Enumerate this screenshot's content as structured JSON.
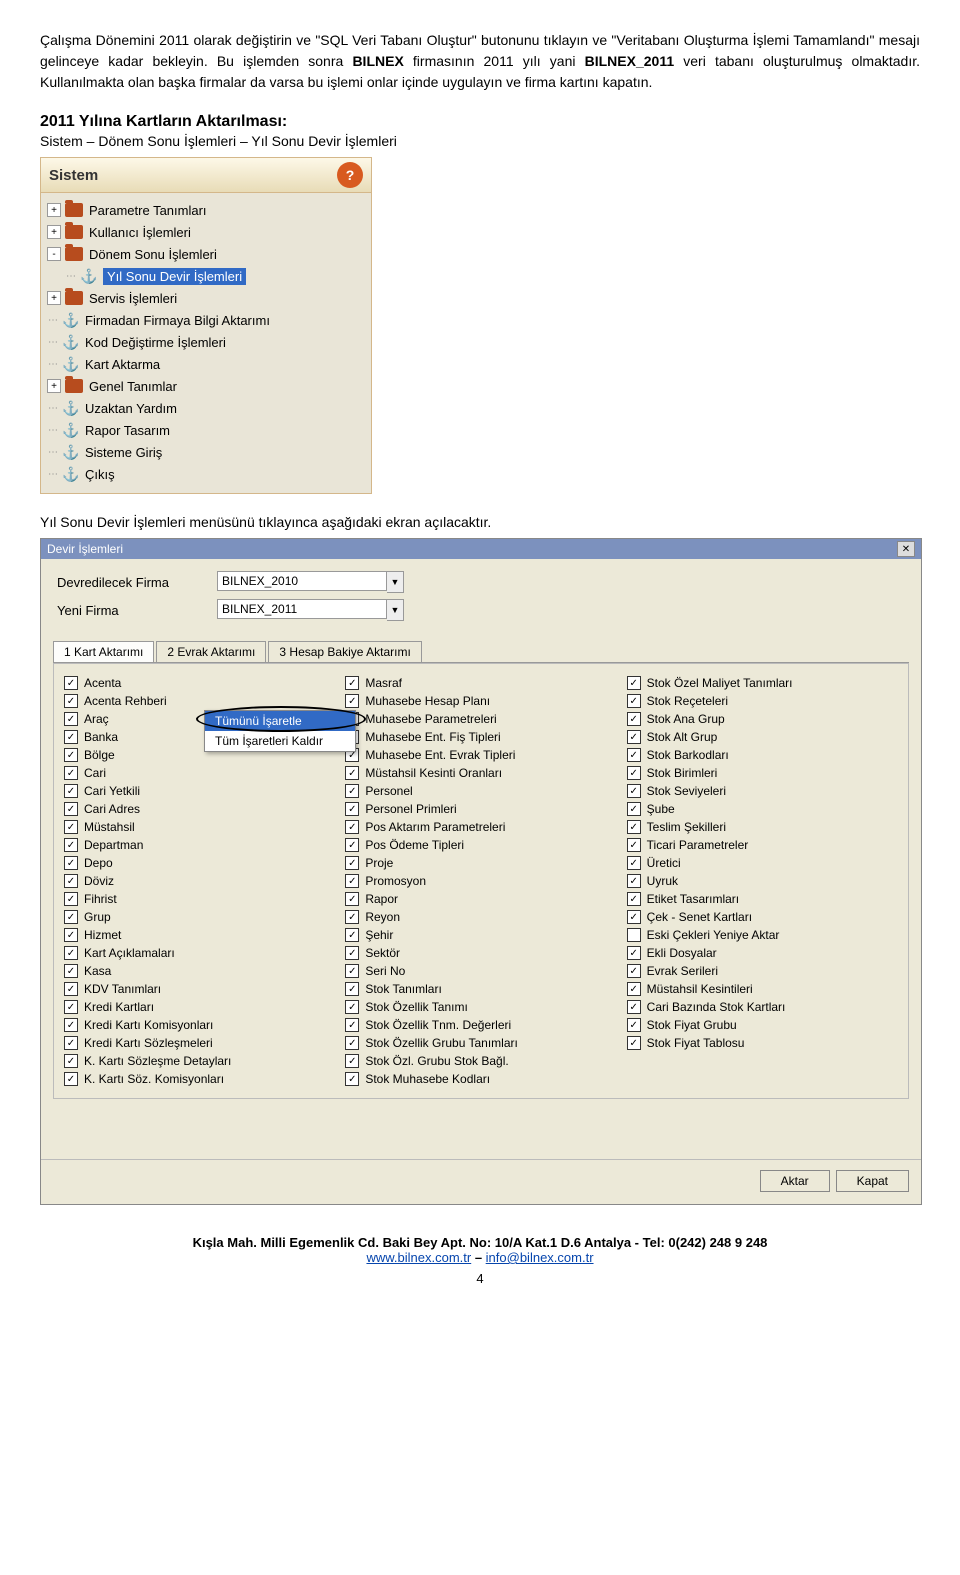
{
  "paragraph1_parts": {
    "p1": "Çalışma Dönemini 2011 olarak değiştirin ve \"SQL Veri Tabanı Oluştur\" butonunu tıklayın ve \"Veritabanı Oluşturma İşlemi Tamamlandı\" mesajı gelinceye kadar bekleyin. Bu işlemden sonra ",
    "p1b": "BILNEX",
    "p1c": " firmasının 2011 yılı yani ",
    "p1d": "BILNEX_2011",
    "p1e": " veri tabanı oluşturulmuş olmaktadır. Kullanılmakta olan başka firmalar da varsa bu işlemi onlar içinde uygulayın ve firma kartını kapatın."
  },
  "heading": "2011 Yılına Kartların Aktarılması:",
  "subline": "Sistem – Dönem Sonu İşlemleri – Yıl Sonu Devir İşlemleri",
  "sistem": {
    "title": "Sistem",
    "items": [
      {
        "exp": "+",
        "icon": "folder",
        "label": "Parametre Tanımları",
        "lvl": 1
      },
      {
        "exp": "+",
        "icon": "folder",
        "label": "Kullanıcı İşlemleri",
        "lvl": 1
      },
      {
        "exp": "-",
        "icon": "folder",
        "label": "Dönem Sonu İşlemleri",
        "lvl": 1
      },
      {
        "exp": "",
        "icon": "anchor",
        "label": "Yıl Sonu Devir İşlemleri",
        "lvl": 2,
        "hl": true
      },
      {
        "exp": "+",
        "icon": "folder",
        "label": "Servis İşlemleri",
        "lvl": 1
      },
      {
        "exp": "",
        "icon": "anchor",
        "label": "Firmadan Firmaya Bilgi Aktarımı",
        "lvl": 1
      },
      {
        "exp": "",
        "icon": "anchor",
        "label": "Kod Değiştirme İşlemleri",
        "lvl": 1
      },
      {
        "exp": "",
        "icon": "anchor",
        "label": "Kart Aktarma",
        "lvl": 1
      },
      {
        "exp": "+",
        "icon": "folder",
        "label": "Genel Tanımlar",
        "lvl": 1
      },
      {
        "exp": "",
        "icon": "anchor",
        "label": "Uzaktan Yardım",
        "lvl": 1
      },
      {
        "exp": "",
        "icon": "anchor",
        "label": "Rapor Tasarım",
        "lvl": 1
      },
      {
        "exp": "",
        "icon": "anchor",
        "label": "Sisteme Giriş",
        "lvl": 1
      },
      {
        "exp": "",
        "icon": "anchor",
        "label": "Çıkış",
        "lvl": 1
      }
    ]
  },
  "afterimg": "Yıl Sonu Devir İşlemleri menüsünü tıklayınca aşağıdaki ekran açılacaktır.",
  "devir": {
    "title": "Devir İşlemleri",
    "firmA_label": "Devredilecek Firma",
    "firmA_val": "BILNEX_2010",
    "firmB_label": "Yeni Firma",
    "firmB_val": "BILNEX_2011",
    "tabs": [
      "1 Kart Aktarımı",
      "2 Evrak Aktarımı",
      "3 Hesap Bakiye Aktarımı"
    ],
    "context": {
      "selectAll": "Tümünü İşaretle",
      "clearAll": "Tüm İşaretleri Kaldır"
    },
    "col1": [
      {
        "c": true,
        "l": "Acenta"
      },
      {
        "c": true,
        "l": "Acenta Rehberi"
      },
      {
        "c": true,
        "l": "Araç"
      },
      {
        "c": true,
        "l": "Banka"
      },
      {
        "c": true,
        "l": "Bölge"
      },
      {
        "c": true,
        "l": "Cari"
      },
      {
        "c": true,
        "l": "Cari Yetkili"
      },
      {
        "c": true,
        "l": "Cari Adres"
      },
      {
        "c": true,
        "l": "Müstahsil"
      },
      {
        "c": true,
        "l": "Departman"
      },
      {
        "c": true,
        "l": "Depo"
      },
      {
        "c": true,
        "l": "Döviz"
      },
      {
        "c": true,
        "l": "Fihrist"
      },
      {
        "c": true,
        "l": "Grup"
      },
      {
        "c": true,
        "l": "Hizmet"
      },
      {
        "c": true,
        "l": "Kart Açıklamaları"
      },
      {
        "c": true,
        "l": "Kasa"
      },
      {
        "c": true,
        "l": "KDV Tanımları"
      },
      {
        "c": true,
        "l": "Kredi Kartları"
      },
      {
        "c": true,
        "l": "Kredi Kartı Komisyonları"
      },
      {
        "c": true,
        "l": "Kredi Kartı Sözleşmeleri"
      },
      {
        "c": true,
        "l": "K. Kartı Sözleşme Detayları"
      },
      {
        "c": true,
        "l": "K. Kartı Söz. Komisyonları"
      }
    ],
    "col2": [
      {
        "c": true,
        "l": "Masraf"
      },
      {
        "c": true,
        "l": "Muhasebe Hesap Planı"
      },
      {
        "c": true,
        "l": "Muhasebe Parametreleri"
      },
      {
        "c": true,
        "l": "Muhasebe Ent. Fiş Tipleri"
      },
      {
        "c": true,
        "l": "Muhasebe Ent. Evrak Tipleri"
      },
      {
        "c": true,
        "l": "Müstahsil Kesinti Oranları"
      },
      {
        "c": true,
        "l": "Personel"
      },
      {
        "c": true,
        "l": "Personel Primleri"
      },
      {
        "c": true,
        "l": "Pos Aktarım Parametreleri"
      },
      {
        "c": true,
        "l": "Pos Ödeme Tipleri"
      },
      {
        "c": true,
        "l": "Proje"
      },
      {
        "c": true,
        "l": "Promosyon"
      },
      {
        "c": true,
        "l": "Rapor"
      },
      {
        "c": true,
        "l": "Reyon"
      },
      {
        "c": true,
        "l": "Şehir"
      },
      {
        "c": true,
        "l": "Sektör"
      },
      {
        "c": true,
        "l": "Seri No"
      },
      {
        "c": true,
        "l": "Stok Tanımları"
      },
      {
        "c": true,
        "l": "Stok Özellik Tanımı"
      },
      {
        "c": true,
        "l": "Stok Özellik Tnm. Değerleri"
      },
      {
        "c": true,
        "l": "Stok Özellik Grubu Tanımları"
      },
      {
        "c": true,
        "l": "Stok Özl. Grubu Stok Bağl."
      },
      {
        "c": true,
        "l": "Stok Muhasebe Kodları"
      }
    ],
    "col3": [
      {
        "c": true,
        "l": "Stok Özel Maliyet Tanımları"
      },
      {
        "c": true,
        "l": "Stok Reçeteleri"
      },
      {
        "c": true,
        "l": "Stok Ana Grup"
      },
      {
        "c": true,
        "l": "Stok Alt Grup"
      },
      {
        "c": true,
        "l": "Stok Barkodları"
      },
      {
        "c": true,
        "l": "Stok Birimleri"
      },
      {
        "c": true,
        "l": "Stok Seviyeleri"
      },
      {
        "c": true,
        "l": "Şube"
      },
      {
        "c": true,
        "l": "Teslim Şekilleri"
      },
      {
        "c": true,
        "l": "Ticari Parametreler"
      },
      {
        "c": true,
        "l": "Üretici"
      },
      {
        "c": true,
        "l": "Uyruk"
      },
      {
        "c": true,
        "l": "Etiket Tasarımları"
      },
      {
        "c": true,
        "l": "Çek - Senet Kartları"
      },
      {
        "c": false,
        "l": "Eski Çekleri Yeniye Aktar"
      },
      {
        "c": true,
        "l": "Ekli Dosyalar"
      },
      {
        "c": true,
        "l": "Evrak Serileri"
      },
      {
        "c": true,
        "l": "Müstahsil Kesintileri"
      },
      {
        "c": true,
        "l": "Cari Bazında Stok Kartları"
      },
      {
        "c": true,
        "l": "Stok Fiyat Grubu"
      },
      {
        "c": true,
        "l": "Stok Fiyat Tablosu"
      }
    ],
    "btn_aktar": "Aktar",
    "btn_kapat": "Kapat"
  },
  "footer": {
    "line1": "Kışla Mah. Milli Egemenlik Cd. Baki Bey Apt. No: 10/A Kat.1 D.6 Antalya - Tel: 0(242) 248 9 248",
    "site": "www.bilnex.com.tr",
    "mail": "info@bilnex.com.tr",
    "sep": "  –  ",
    "page": "4"
  }
}
